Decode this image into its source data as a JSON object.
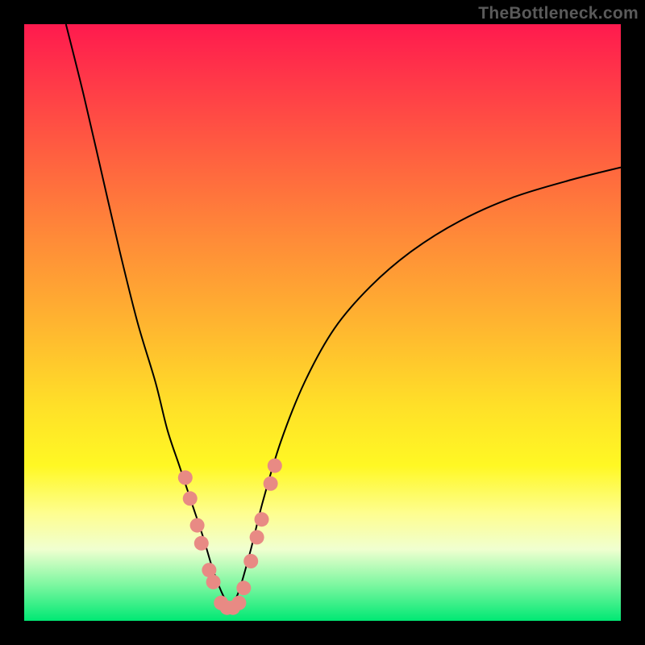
{
  "attribution": "TheBottleneck.com",
  "chart_data": {
    "type": "line",
    "title": "",
    "xlabel": "",
    "ylabel": "",
    "xlim": [
      0,
      100
    ],
    "ylim": [
      0,
      100
    ],
    "curve_left": {
      "comment": "descending branch; y is % height from bottom",
      "x": [
        7,
        10,
        13,
        16,
        19,
        22,
        24,
        26,
        28,
        30,
        31.5,
        33,
        34.5
      ],
      "y": [
        100,
        88,
        75,
        62,
        50,
        40,
        32,
        26,
        20,
        14,
        9,
        5,
        2
      ]
    },
    "curve_right": {
      "comment": "ascending branch",
      "x": [
        34.5,
        36,
        38,
        40,
        43,
        47,
        52,
        58,
        65,
        73,
        82,
        92,
        100
      ],
      "y": [
        2,
        5,
        12,
        20,
        30,
        40,
        49,
        56,
        62,
        67,
        71,
        74,
        76
      ]
    },
    "overlay_dots": {
      "comment": "salmon dots clustered near the V minimum; approximate (x%, y% from bottom)",
      "points": [
        [
          27.0,
          24.0
        ],
        [
          27.8,
          20.5
        ],
        [
          29.0,
          16.0
        ],
        [
          29.7,
          13.0
        ],
        [
          31.0,
          8.5
        ],
        [
          31.7,
          6.5
        ],
        [
          33.0,
          3.0
        ],
        [
          34.0,
          2.2
        ],
        [
          35.0,
          2.2
        ],
        [
          36.0,
          3.0
        ],
        [
          36.8,
          5.5
        ],
        [
          38.0,
          10.0
        ],
        [
          39.0,
          14.0
        ],
        [
          39.8,
          17.0
        ],
        [
          41.3,
          23.0
        ],
        [
          42.0,
          26.0
        ]
      ],
      "color": "#e88a84",
      "radius": 9
    },
    "curve_stroke": "#000000",
    "curve_width": 2
  }
}
